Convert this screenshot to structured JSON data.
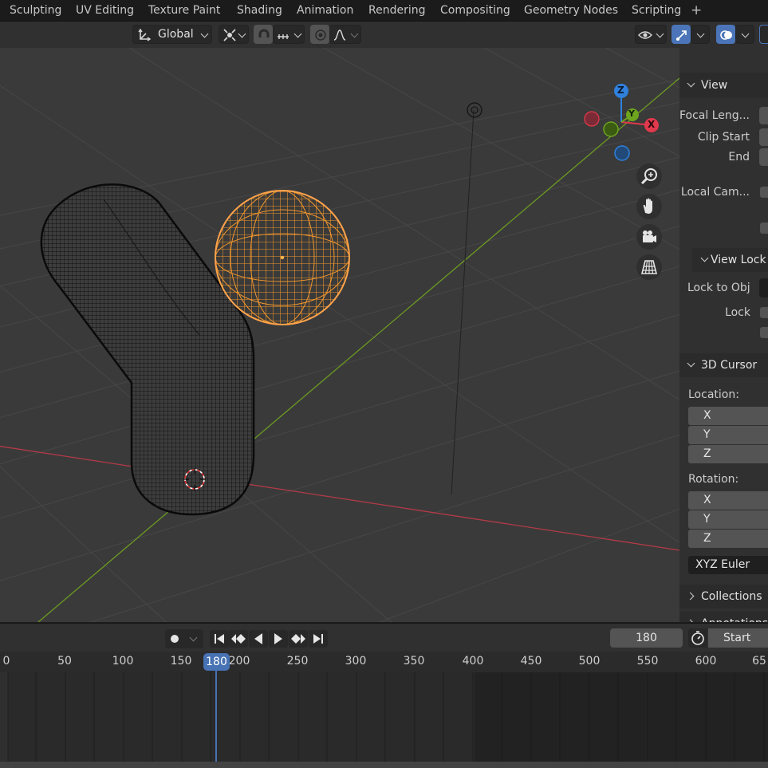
{
  "workspace_tabs": [
    "Sculpting",
    "UV Editing",
    "Texture Paint",
    "Shading",
    "Animation",
    "Rendering",
    "Compositing",
    "Geometry Nodes",
    "Scripting",
    "+"
  ],
  "header": {
    "transform_orientation": "Global"
  },
  "gizmo": {
    "z": "Z",
    "y": "Y",
    "x": "X"
  },
  "sidebar": {
    "view_panel": {
      "title": "View",
      "focal_length": "Focal Leng...",
      "clip_start": "Clip Start",
      "end": "End",
      "local_camera": "Local Cam..."
    },
    "view_lock_panel": {
      "title": "View Lock",
      "lock_to_object": "Lock to Obj",
      "lock": "Lock"
    },
    "cursor_panel": {
      "title": "3D Cursor",
      "location_label": "Location:",
      "location_axes": [
        "X",
        "Y",
        "Z"
      ],
      "rotation_label": "Rotation:",
      "rotation_axes": [
        "X",
        "Y",
        "Z"
      ],
      "rotation_mode": "XYZ Euler"
    },
    "collections_panel": {
      "title": "Collections"
    },
    "annotations_panel": {
      "title": "Annotations"
    }
  },
  "timeline": {
    "current_frame": "180",
    "start_label": "Start",
    "playhead_label": "180",
    "ruler_ticks": [
      "0",
      "50",
      "100",
      "150",
      "200",
      "250",
      "300",
      "350",
      "400",
      "450",
      "500",
      "550",
      "600",
      "65"
    ]
  },
  "colors": {
    "selected_object": "#e58a2a",
    "axis_x": "#b33a48",
    "axis_y": "#6c9a22",
    "gizmo_z": "#2f81dd",
    "gizmo_x": "#e0394c",
    "gizmo_y": "#6ea51f",
    "playhead": "#4772b3"
  }
}
